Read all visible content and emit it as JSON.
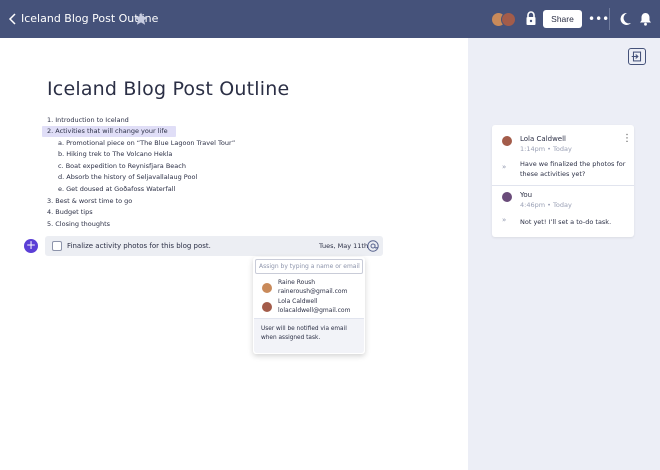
{
  "header": {
    "title": "Iceland Blog Post Outline",
    "share_label": "Share",
    "more_label": "•••",
    "colors": {
      "bar": "#45527a",
      "accent": "#5b3fd6"
    }
  },
  "document": {
    "title": "Iceland Blog Post Outline",
    "outline": [
      "1. Introduction to Iceland",
      "2. Activities that will change your life",
      "a. Promotional piece on “The Blue Lagoon Travel Tour”",
      "b. Hiking trek to The Volcano Hekla",
      "c. Boat expedition to Reynisfjara Beach",
      "d. Absorb the history of Seljavallalaug Pool",
      "e. Get doused at Goðafoss Waterfall",
      "3. Best & worst time to go",
      "4. Budget tips",
      "5. Closing thoughts"
    ],
    "task": {
      "text": "Finalize activity photos for this blog post.",
      "date": "Tues, May 11th",
      "add_label": "+"
    }
  },
  "assign_popover": {
    "placeholder": "Assign by typing a name or email",
    "users": [
      {
        "name": "Raine Roush",
        "email": "raineroush@gmail.com"
      },
      {
        "name": "Lola Caldwell",
        "email": "lolacaldwell@gmail.com"
      }
    ],
    "note": "User will be notified via email when assigned task."
  },
  "comments": [
    {
      "author": "Lola Caldwell",
      "time": "1:14pm • Today",
      "text": "Have we finalized the photos for these activities yet?"
    },
    {
      "author": "You",
      "time": "4:46pm • Today",
      "text": "Not yet! I’ll set a to-do task."
    }
  ],
  "comment_menu": "⋮",
  "reply_icon": "»"
}
